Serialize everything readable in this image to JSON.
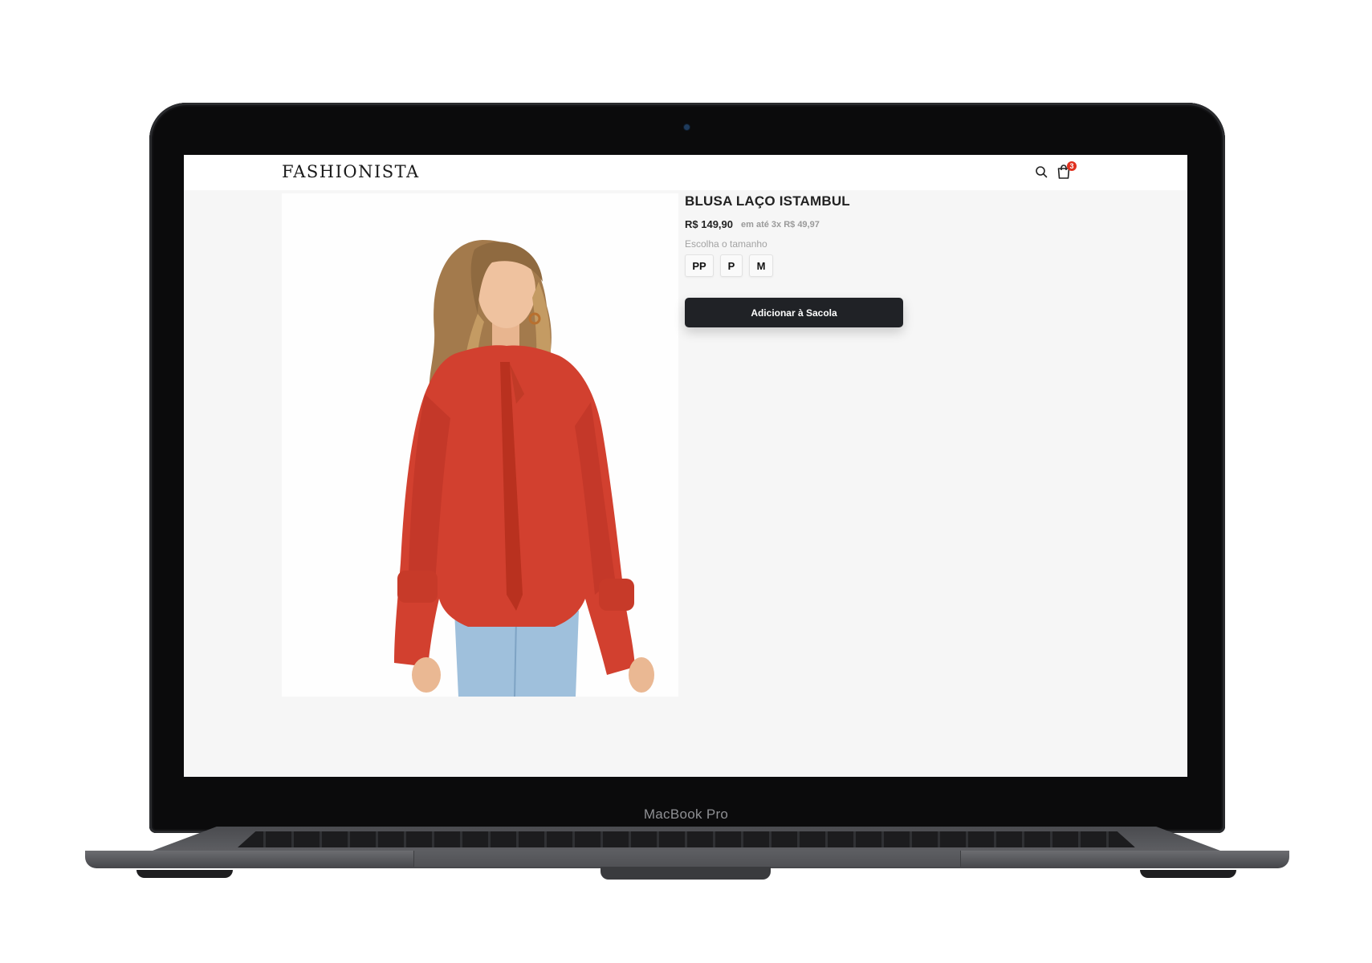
{
  "device": {
    "label": "MacBook Pro"
  },
  "header": {
    "logo": "FASHIONISTA",
    "cart_count": "3"
  },
  "product": {
    "name": "BLUSA LAÇO ISTAMBUL",
    "price": "R$ 149,90",
    "installments": "em até 3x R$ 49,97",
    "size_prompt": "Escolha o tamanho",
    "sizes": [
      "PP",
      "P",
      "M"
    ],
    "add_to_bag_label": "Adicionar à Sacola",
    "image_subject": "woman wearing red long-sleeve tie-neck blouse and light blue jeans"
  },
  "colors": {
    "accent_dark": "#202226",
    "badge_red": "#e0311f",
    "blouse_red": "#d2402f"
  }
}
